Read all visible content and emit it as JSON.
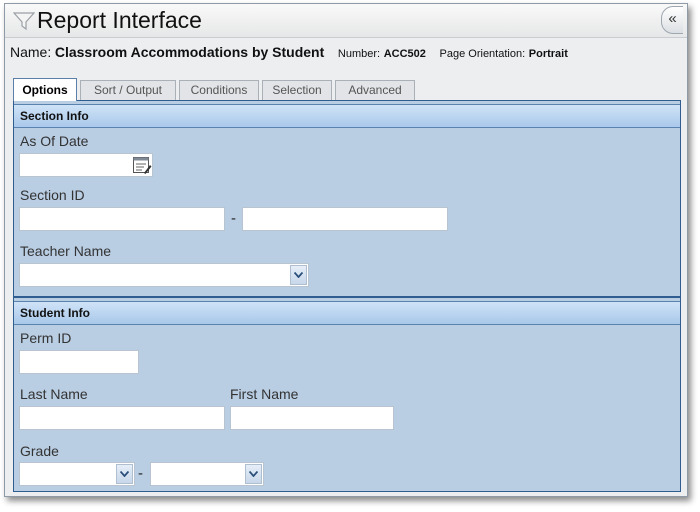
{
  "window": {
    "title": "Report Interface",
    "collapse_label": "«"
  },
  "report": {
    "name_label": "Name:",
    "name_value": "Classroom Accommodations by Student",
    "number_label": "Number:",
    "number_value": "ACC502",
    "orientation_label": "Page Orientation:",
    "orientation_value": "Portrait"
  },
  "tabs": [
    {
      "label": "Options",
      "active": true
    },
    {
      "label": "Sort / Output",
      "active": false
    },
    {
      "label": "Conditions",
      "active": false
    },
    {
      "label": "Selection",
      "active": false
    },
    {
      "label": "Advanced",
      "active": false
    }
  ],
  "section_info": {
    "header": "Section Info",
    "as_of_date": {
      "label": "As Of Date",
      "value": ""
    },
    "section_id": {
      "label": "Section ID",
      "from": "",
      "to": "",
      "separator": "-"
    },
    "teacher_name": {
      "label": "Teacher Name",
      "value": ""
    }
  },
  "student_info": {
    "header": "Student Info",
    "perm_id": {
      "label": "Perm ID",
      "value": ""
    },
    "last_name": {
      "label": "Last Name",
      "value": ""
    },
    "first_name": {
      "label": "First Name",
      "value": ""
    },
    "grade": {
      "label": "Grade",
      "from": "",
      "to": "",
      "separator": "-"
    }
  },
  "icons": {
    "filter": "filter-icon",
    "calendar": "calendar-icon",
    "dropdown": "chevron-down-icon"
  },
  "colors": {
    "panel_bg": "#b9cde3",
    "panel_border": "#2f5d8f",
    "section_header": "#a9c8ea"
  }
}
